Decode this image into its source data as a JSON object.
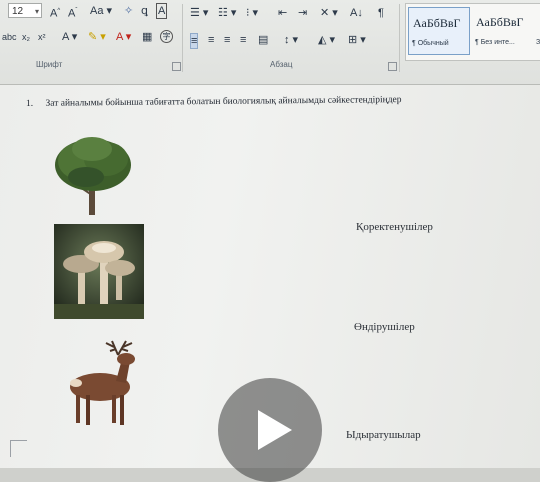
{
  "ribbon": {
    "font_size": "12",
    "font_group_label": "Шрифт",
    "paragraph_group_label": "Абзац",
    "styles": [
      {
        "sample": "АаБбВвГ",
        "name": "¶ Обычный"
      },
      {
        "sample": "АаБбВвГ",
        "name": "¶ Без инте..."
      },
      {
        "sample": "Заг",
        "name": "За"
      }
    ]
  },
  "document": {
    "question_number": "1.",
    "question_text": "Зат айналымы бойынша табиғатта болатын биологиялық айналымды сәйкестендіріңдер",
    "labels": [
      "Қоректенушілер",
      "Өндірушілер",
      "Ыдыратушылар"
    ],
    "images": [
      "tree",
      "mushrooms",
      "deer"
    ]
  },
  "overlay": {
    "play_icon": "play-icon"
  },
  "colors": {
    "ribbon_bg": "#e6e8e5",
    "doc_bg": "#eff0ee",
    "accent": "#7aa0c8"
  }
}
